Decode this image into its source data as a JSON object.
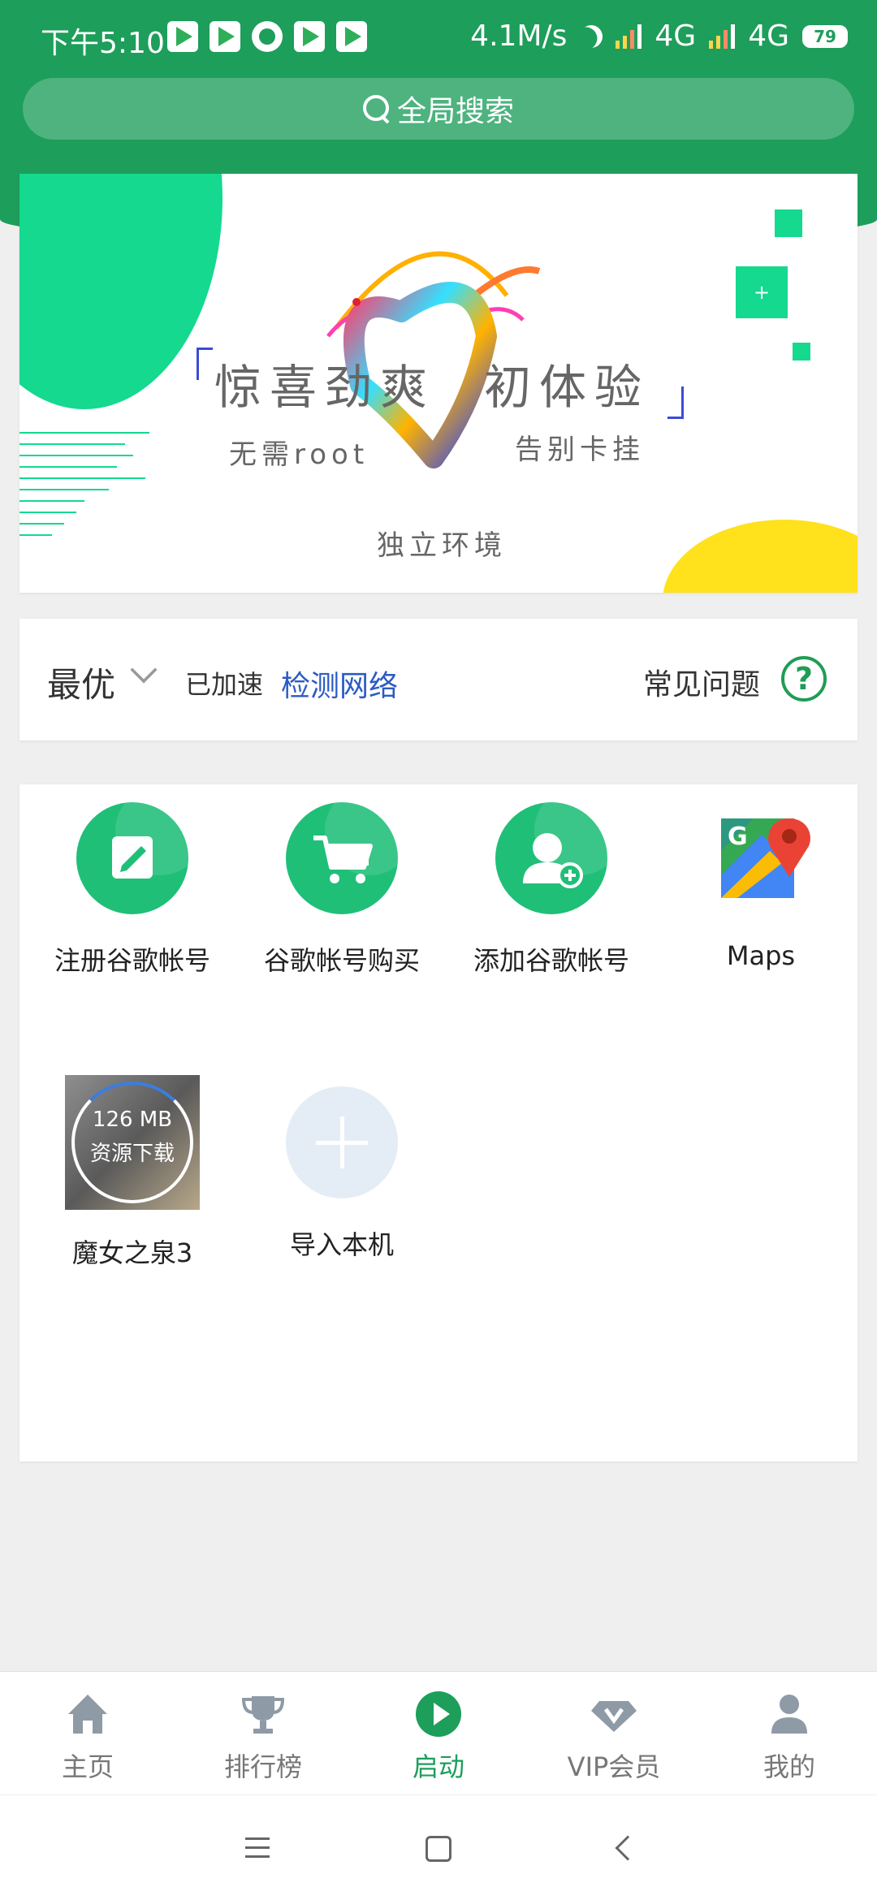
{
  "status_bar": {
    "time": "下午5:10",
    "speed": "4.1M/s",
    "network1": "4G",
    "network2": "4G",
    "battery": "79"
  },
  "search": {
    "label": "全局搜索"
  },
  "banner": {
    "headline_left": "惊喜劲爽",
    "headline_right": "初体验",
    "sub_left": "无需root",
    "sub_right": "告别卡挂",
    "sub_bottom": "独立环境",
    "sq_plus": "+"
  },
  "network": {
    "mode": "最优",
    "status": "已加速",
    "detect": "检测网络",
    "faq": "常见问题",
    "help_glyph": "?"
  },
  "apps": {
    "register": "注册谷歌帐号",
    "buy": "谷歌帐号购买",
    "add": "添加谷歌帐号",
    "maps": "Maps",
    "game": "魔女之泉3",
    "game_size": "126 MB",
    "game_status": "资源下载",
    "import": "导入本机"
  },
  "nav": {
    "home": "主页",
    "rank": "排行榜",
    "launch": "启动",
    "vip": "VIP会员",
    "mine": "我的"
  },
  "colors": {
    "brand": "#1d9e5b",
    "accent": "#14d98f",
    "link": "#2b5bc4"
  }
}
